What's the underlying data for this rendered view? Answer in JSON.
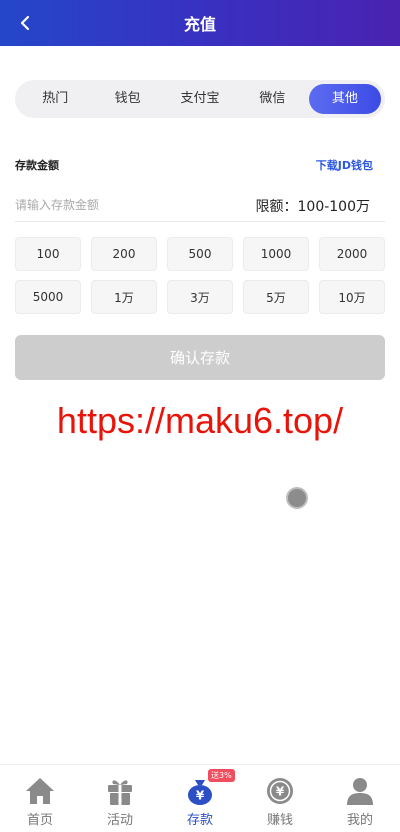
{
  "header": {
    "title": "充值",
    "back_icon": "chevron-left-icon"
  },
  "tabs": [
    {
      "label": "热门",
      "active": false
    },
    {
      "label": "钱包",
      "active": false
    },
    {
      "label": "支付宝",
      "active": false
    },
    {
      "label": "微信",
      "active": false
    },
    {
      "label": "其他",
      "active": true
    }
  ],
  "form": {
    "amount_label": "存款金额",
    "download_link": "下载JD钱包",
    "amount_placeholder": "请输入存款金额",
    "amount_value": "",
    "limit_text": "限额：100-100万"
  },
  "quick_amounts": [
    "100",
    "200",
    "500",
    "1000",
    "2000",
    "5000",
    "1万",
    "3万",
    "5万",
    "10万"
  ],
  "confirm_label": "确认存款",
  "watermark": "https://maku6.top/",
  "tabbar": {
    "items": [
      {
        "label": "首页",
        "icon": "home-icon",
        "active": false
      },
      {
        "label": "活动",
        "icon": "gift-icon",
        "active": false
      },
      {
        "label": "存款",
        "icon": "money-bag-icon",
        "active": true,
        "badge": "送3%"
      },
      {
        "label": "赚钱",
        "icon": "yen-coin-icon",
        "active": false
      },
      {
        "label": "我的",
        "icon": "user-icon",
        "active": false
      }
    ]
  },
  "colors": {
    "header_start": "#2447c9",
    "header_end": "#4a23b0",
    "accent": "#3d4be6",
    "link": "#2c58e0",
    "watermark": "#e8140a"
  }
}
